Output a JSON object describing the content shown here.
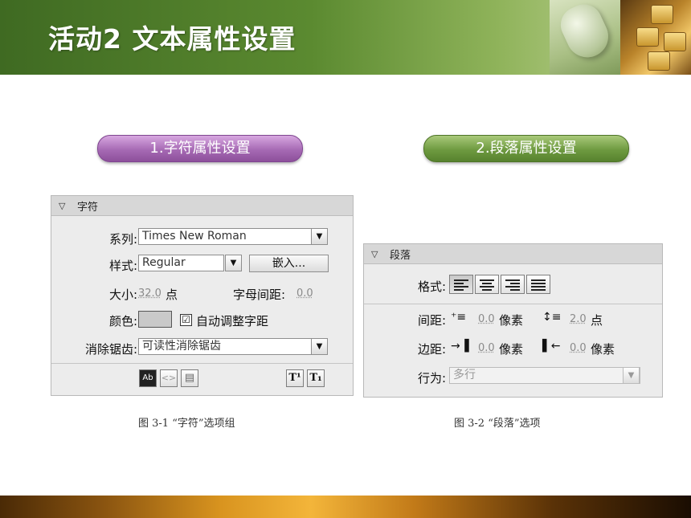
{
  "slide": {
    "title": "活动2  文本属性设置"
  },
  "sections": {
    "char_pill": "1.字符属性设置",
    "para_pill": "2.段落属性设置"
  },
  "char_panel": {
    "header": "字符",
    "family_label": "系列:",
    "family_value": "Times New Roman",
    "style_label": "样式:",
    "style_value": "Regular",
    "embed_button": "嵌入...",
    "size_label": "大小:",
    "size_value": "32.0",
    "size_unit": "点",
    "letter_spacing_label": "字母间距:",
    "letter_spacing_value": "0.0",
    "color_label": "颜色:",
    "color_value": "#c9c9c9",
    "auto_kern_label": "自动调整字距",
    "auto_kern_checked": "☑",
    "antialias_label": "消除锯齿:",
    "antialias_value": "可读性消除锯齿",
    "toolbar": {
      "selectable": "Ab",
      "html": "<>",
      "border": "▤",
      "superscript": "T¹",
      "subscript": "T₁"
    },
    "caption": "图 3-1  “字符”选项组"
  },
  "para_panel": {
    "header": "段落",
    "format_label": "格式:",
    "spacing_label": "间距:",
    "indent_value": "0.0",
    "indent_unit": "像素",
    "line_spacing_value": "2.0",
    "line_spacing_unit": "点",
    "margin_label": "边距:",
    "left_margin_value": "0.0",
    "left_margin_unit": "像素",
    "right_margin_value": "0.0",
    "right_margin_unit": "像素",
    "behavior_label": "行为:",
    "behavior_value": "多行",
    "caption": "图 3-2  “段落”选项"
  }
}
